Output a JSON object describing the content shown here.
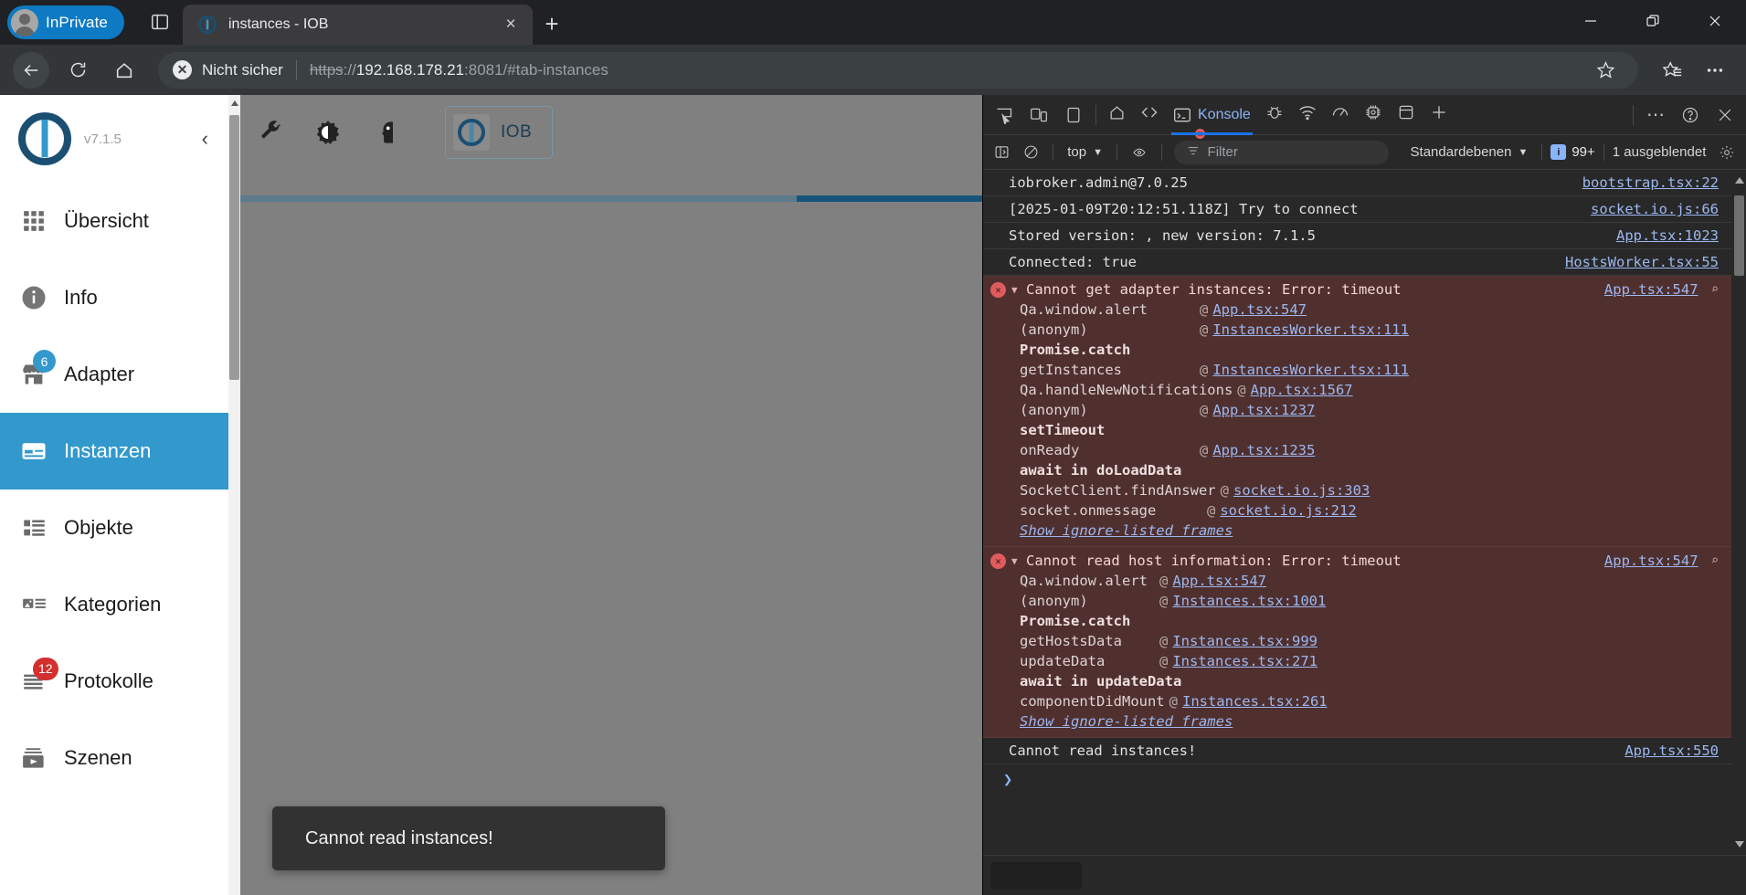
{
  "browser": {
    "profile_label": "InPrivate",
    "tab": {
      "title": "instances - IOB",
      "favicon": "iobroker-favicon",
      "close_label": "×"
    },
    "newtab_label": "+",
    "window_controls": {
      "minimize": "—",
      "restore": "❐",
      "close": "✕"
    },
    "address": {
      "security_label": "Nicht sicher",
      "security_icon_glyph": "✕",
      "url_scheme": "https",
      "url_separator": "://",
      "url_host": "192.168.178.21",
      "url_rest": ":8081/#tab-instances"
    },
    "nav": {
      "back": "←",
      "reload": "⟳",
      "home": "⌂",
      "favorite": "☆",
      "collections": "☆≡",
      "settings": "…"
    }
  },
  "admin": {
    "version": "v7.1.5",
    "collapse_icon": "‹",
    "sidebar_items": [
      {
        "label": "Übersicht",
        "icon": "grid-icon",
        "badge": null,
        "active": false
      },
      {
        "label": "Info",
        "icon": "info-icon",
        "badge": null,
        "active": false
      },
      {
        "label": "Adapter",
        "icon": "store-icon",
        "badge": "6",
        "badge_color": "blue",
        "active": false
      },
      {
        "label": "Instanzen",
        "icon": "instances-icon",
        "badge": null,
        "active": true
      },
      {
        "label": "Objekte",
        "icon": "list-icon",
        "badge": null,
        "active": false
      },
      {
        "label": "Kategorien",
        "icon": "categories-icon",
        "badge": null,
        "active": false
      },
      {
        "label": "Protokolle",
        "icon": "logs-icon",
        "badge": "12",
        "badge_color": "red",
        "active": false
      },
      {
        "label": "Szenen",
        "icon": "scenes-icon",
        "badge": null,
        "active": false
      }
    ],
    "toolbar": {
      "wrench": "wrench-icon",
      "contrast": "contrast-icon",
      "expert": "expert-icon",
      "host_chip_label": "IOB"
    },
    "progress_percent": 75,
    "toast_message": "Cannot read instances!",
    "accent_color": "#3399cc"
  },
  "devtools": {
    "left_icons": [
      "inspect-icon",
      "device-toolbar-icon",
      "dock-panel-icon"
    ],
    "tabs": [
      {
        "label": "",
        "icon": "home-icon",
        "active": false
      },
      {
        "label": "",
        "icon": "elements-icon",
        "active": false
      },
      {
        "label": "Konsole",
        "icon": "console-icon",
        "active": true,
        "error_badge": "x"
      },
      {
        "label": "",
        "icon": "debugger-icon",
        "active": false
      },
      {
        "label": "",
        "icon": "network-icon",
        "active": false
      },
      {
        "label": "",
        "icon": "performance-icon",
        "active": false
      },
      {
        "label": "",
        "icon": "memory-icon",
        "active": false
      },
      {
        "label": "",
        "icon": "application-icon",
        "active": false
      },
      {
        "label": "",
        "icon": "add-panel-icon",
        "active": false
      }
    ],
    "tabbar_right": {
      "more": "⋯",
      "help": "?",
      "close": "✕"
    },
    "filterbar": {
      "sidebar_toggle": "console-sidebar-icon",
      "clear": "clear-console-icon",
      "context": "top",
      "eye": "live-expression-icon",
      "filter_placeholder": "Filter",
      "levels": "Standardebenen",
      "issues_count": "99+",
      "hidden_text": "1 ausgeblendet",
      "settings": "gear-icon"
    },
    "console_rows": [
      {
        "type": "log",
        "text": "iobroker.admin@7.0.25",
        "source": "bootstrap.tsx:22"
      },
      {
        "type": "log",
        "text": "[2025-01-09T20:12:51.118Z] Try to connect",
        "source": "socket.io.js:66"
      },
      {
        "type": "log",
        "text": "Stored version: , new version: 7.1.5",
        "source": "App.tsx:1023"
      },
      {
        "type": "log",
        "text": "Connected: true",
        "source": "HostsWorker.tsx:55"
      }
    ],
    "errors": [
      {
        "title": "Cannot get adapter instances: Error: timeout",
        "source": "App.tsx:547",
        "stack": [
          {
            "kind": "frame",
            "fn": "Qa.window.alert",
            "at": "@",
            "link": "App.tsx:547"
          },
          {
            "kind": "frame",
            "fn": "(anonym)",
            "at": "@",
            "link": "InstancesWorker.tsx:111"
          },
          {
            "kind": "label",
            "fn": "Promise.catch"
          },
          {
            "kind": "frame",
            "fn": "getInstances",
            "at": "@",
            "link": "InstancesWorker.tsx:111"
          },
          {
            "kind": "frame",
            "fn": "Qa.handleNewNotifications",
            "at": "@",
            "link": "App.tsx:1567"
          },
          {
            "kind": "frame",
            "fn": "(anonym)",
            "at": "@",
            "link": "App.tsx:1237"
          },
          {
            "kind": "label",
            "fn": "setTimeout"
          },
          {
            "kind": "frame",
            "fn": "onReady",
            "at": "@",
            "link": "App.tsx:1235"
          },
          {
            "kind": "label",
            "fn": "await in doLoadData"
          },
          {
            "kind": "frame",
            "fn": "SocketClient.findAnswer",
            "at": "@",
            "link": "socket.io.js:303"
          },
          {
            "kind": "frame",
            "fn": "socket.onmessage",
            "at": "@",
            "link": "socket.io.js:212"
          }
        ],
        "show_more": "Show ignore-listed frames"
      },
      {
        "title": "Cannot read host information: Error: timeout",
        "source": "App.tsx:547",
        "stack": [
          {
            "kind": "frame",
            "fn": "Qa.window.alert",
            "at": "@",
            "link": "App.tsx:547"
          },
          {
            "kind": "frame",
            "fn": "(anonym)",
            "at": "@",
            "link": "Instances.tsx:1001"
          },
          {
            "kind": "label",
            "fn": "Promise.catch"
          },
          {
            "kind": "frame",
            "fn": "getHostsData",
            "at": "@",
            "link": "Instances.tsx:999"
          },
          {
            "kind": "frame",
            "fn": "updateData",
            "at": "@",
            "link": "Instances.tsx:271"
          },
          {
            "kind": "label",
            "fn": "await in updateData"
          },
          {
            "kind": "frame",
            "fn": "componentDidMount",
            "at": "@",
            "link": "Instances.tsx:261"
          }
        ],
        "show_more": "Show ignore-listed frames"
      }
    ],
    "final_row": {
      "text": "Cannot read instances!",
      "source": "App.tsx:550"
    },
    "prompt_symbol": "❯"
  }
}
